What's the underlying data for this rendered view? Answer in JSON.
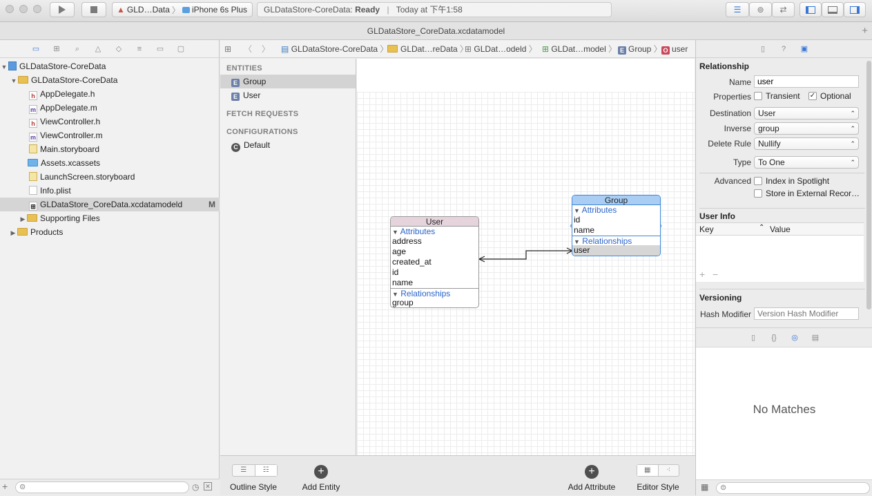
{
  "toolbar": {
    "scheme": "GLD…Data",
    "device": "iPhone 6s Plus",
    "activity_project": "GLDataStore-CoreData: ",
    "activity_status": "Ready",
    "activity_time": "Today at 下午1:58"
  },
  "tab": {
    "title": "GLDataStore_CoreData.xcdatamodel"
  },
  "navigator": {
    "items": [
      {
        "label": "GLDataStore-CoreData",
        "kind": "project",
        "depth": 0
      },
      {
        "label": "GLDataStore-CoreData",
        "kind": "folder",
        "depth": 1
      },
      {
        "label": "AppDelegate.h",
        "kind": "h",
        "depth": 2
      },
      {
        "label": "AppDelegate.m",
        "kind": "m",
        "depth": 2
      },
      {
        "label": "ViewController.h",
        "kind": "h",
        "depth": 2
      },
      {
        "label": "ViewController.m",
        "kind": "m",
        "depth": 2
      },
      {
        "label": "Main.storyboard",
        "kind": "storyboard",
        "depth": 2
      },
      {
        "label": "Assets.xcassets",
        "kind": "assets",
        "depth": 2
      },
      {
        "label": "LaunchScreen.storyboard",
        "kind": "storyboard",
        "depth": 2
      },
      {
        "label": "Info.plist",
        "kind": "plist",
        "depth": 2
      },
      {
        "label": "GLDataStore_CoreData.xcdatamodeld",
        "kind": "model",
        "depth": 2,
        "badge": "M"
      },
      {
        "label": "Supporting Files",
        "kind": "folder",
        "depth": 2
      },
      {
        "label": "Products",
        "kind": "folder",
        "depth": 1
      }
    ]
  },
  "jumpbar": {
    "crumbs": [
      "GLDataStore-CoreData",
      "GLDat…reData",
      "GLDat…odeld",
      "GLDat…model",
      "Group",
      "user"
    ]
  },
  "outline": {
    "entities_header": "ENTITIES",
    "entities": [
      "Group",
      "User"
    ],
    "fetch_header": "FETCH REQUESTS",
    "config_header": "CONFIGURATIONS",
    "configurations": [
      "Default"
    ],
    "entity_icon": "E",
    "config_icon": "C"
  },
  "diagram": {
    "user_entity": {
      "title": "User",
      "attributes_label": "Attributes",
      "attributes": [
        "address",
        "age",
        "created_at",
        "id",
        "name"
      ],
      "relationships_label": "Relationships",
      "relationships": [
        "group"
      ]
    },
    "group_entity": {
      "title": "Group",
      "attributes_label": "Attributes",
      "attributes": [
        "id",
        "name"
      ],
      "relationships_label": "Relationships",
      "relationships": [
        "user"
      ]
    }
  },
  "bottombar": {
    "outline_style": "Outline Style",
    "add_entity": "Add Entity",
    "add_attribute": "Add Attribute",
    "editor_style": "Editor Style"
  },
  "inspector": {
    "relationship_header": "Relationship",
    "name_label": "Name",
    "name_value": "user",
    "properties_label": "Properties",
    "transient_label": "Transient",
    "transient_checked": false,
    "optional_label": "Optional",
    "optional_checked": true,
    "destination_label": "Destination",
    "destination_value": "User",
    "inverse_label": "Inverse",
    "inverse_value": "group",
    "delete_rule_label": "Delete Rule",
    "delete_rule_value": "Nullify",
    "type_label": "Type",
    "type_value": "To One",
    "advanced_label": "Advanced",
    "spotlight_label": "Index in Spotlight",
    "external_label": "Store in External Recor…",
    "user_info_header": "User Info",
    "key_col": "Key",
    "value_col": "Value",
    "versioning_header": "Versioning",
    "hash_label": "Hash Modifier",
    "hash_placeholder": "Version Hash Modifier"
  },
  "library": {
    "empty_text": "No Matches"
  },
  "colors": {
    "user_header": "#e6d4dc",
    "group_header": "#a9cdf3",
    "group_border": "#3c86d8",
    "link": "#2a63c9"
  }
}
